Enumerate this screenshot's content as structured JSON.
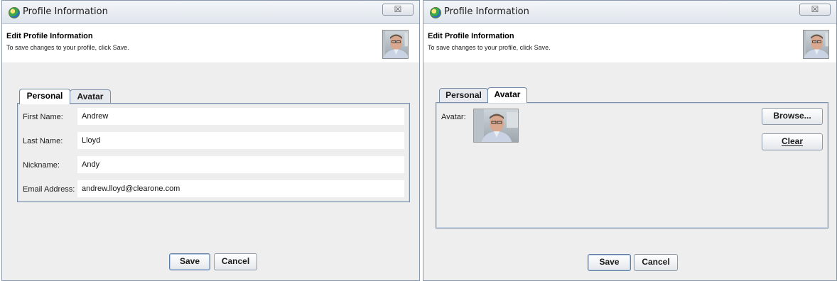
{
  "dialogs": [
    {
      "title": "Profile Information",
      "close_glyph": "☒",
      "header": {
        "title": "Edit Profile Information",
        "subtitle": "To save changes to your profile, click Save."
      },
      "tabs": [
        {
          "label": "Personal",
          "selected": true
        },
        {
          "label": "Avatar",
          "selected": false
        }
      ],
      "fields": [
        {
          "label": "First Name:",
          "value": "Andrew"
        },
        {
          "label": "Last Name:",
          "value": "Lloyd"
        },
        {
          "label": "Nickname:",
          "value": "Andy"
        },
        {
          "label": "Email Address:",
          "value": "andrew.lloyd@clearone.com"
        }
      ],
      "buttons": {
        "save": "Save",
        "cancel": "Cancel"
      }
    },
    {
      "title": "Profile Information",
      "close_glyph": "☒",
      "header": {
        "title": "Edit Profile Information",
        "subtitle": "To save changes to your profile, click Save."
      },
      "tabs": [
        {
          "label": "Personal",
          "selected": false
        },
        {
          "label": "Avatar",
          "selected": true
        }
      ],
      "avatar": {
        "label": "Avatar:",
        "browse": "Browse...",
        "clear": "Clear"
      },
      "buttons": {
        "save": "Save",
        "cancel": "Cancel"
      }
    }
  ]
}
